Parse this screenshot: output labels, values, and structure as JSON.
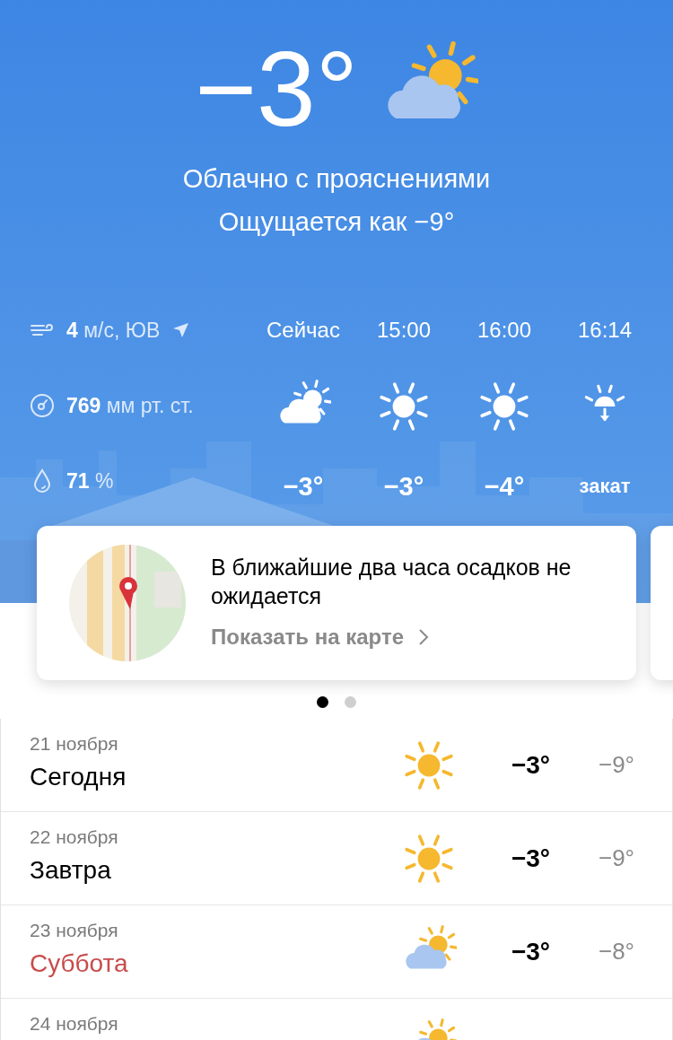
{
  "current": {
    "temperature": "−3°",
    "kind": "partly_cloudy",
    "condition": "Облачно с прояснениями",
    "feels_like": "Ощущается как −9°"
  },
  "details": [
    {
      "kind": "wind",
      "value": "4",
      "unit": "м/с, ЮВ"
    },
    {
      "kind": "pressure",
      "value": "769",
      "unit": "мм рт. ст."
    },
    {
      "kind": "humidity",
      "value": "71",
      "unit": "%"
    }
  ],
  "hourly": [
    {
      "time": "Сейчас",
      "kind": "partly_cloudy",
      "value": "−3°"
    },
    {
      "time": "15:00",
      "kind": "sun",
      "value": "−3°"
    },
    {
      "time": "16:00",
      "kind": "sun",
      "value": "−4°"
    },
    {
      "time": "16:14",
      "kind": "sunset",
      "value": "закат"
    }
  ],
  "nowcast": {
    "message": "В ближайшие два часа осадков не ожидается",
    "link": "Показать на карте"
  },
  "pager": [
    {
      "selected": true
    },
    {
      "selected": false
    }
  ],
  "days": [
    {
      "date": "21 ноября",
      "name": "Сегодня",
      "weekend": false,
      "kind": "sun",
      "high": "−3°",
      "low": "−9°"
    },
    {
      "date": "22 ноября",
      "name": "Завтра",
      "weekend": false,
      "kind": "sun",
      "high": "−3°",
      "low": "−9°"
    },
    {
      "date": "23 ноября",
      "name": "Суббота",
      "weekend": true,
      "kind": "partly_cloudy",
      "high": "−3°",
      "low": "−8°"
    },
    {
      "date": "24 ноября",
      "kind": "partly_cloudy"
    }
  ]
}
